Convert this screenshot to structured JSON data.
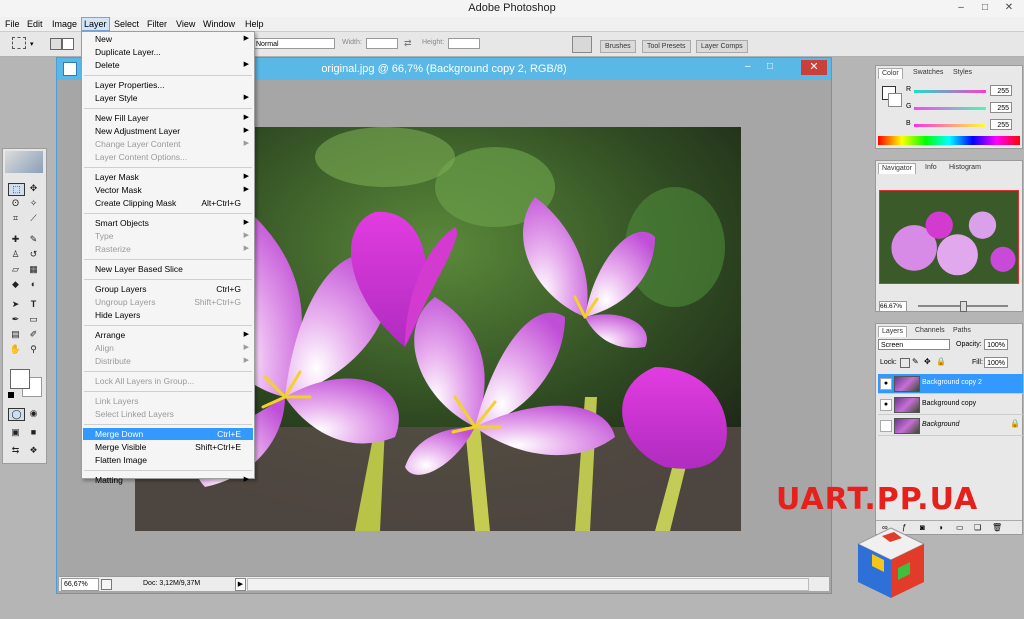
{
  "app": {
    "title": "Adobe Photoshop"
  },
  "window_controls": [
    "–",
    "□",
    "✕"
  ],
  "menubar": [
    "File",
    "Edit",
    "Image",
    "Layer",
    "Select",
    "Filter",
    "View",
    "Window",
    "Help"
  ],
  "options": {
    "mode": "Normal",
    "width_label": "Width:",
    "height_label": "Height:",
    "panel_tabs": [
      "Brushes",
      "Tool Presets",
      "Layer Comps"
    ]
  },
  "document": {
    "title": "original.jpg @ 66,7% (Background copy 2, RGB/8)",
    "zoom": "66,67%",
    "doc_info": "Doc: 3,12M/9,37M"
  },
  "layer_menu": {
    "items": [
      {
        "label": "New",
        "shortcut": "",
        "submenu": true,
        "disabled": false
      },
      {
        "label": "Duplicate Layer...",
        "shortcut": "",
        "submenu": false,
        "disabled": false
      },
      {
        "label": "Delete",
        "shortcut": "",
        "submenu": true,
        "disabled": false
      },
      {
        "sep": true
      },
      {
        "label": "Layer Properties...",
        "shortcut": "",
        "submenu": false,
        "disabled": false
      },
      {
        "label": "Layer Style",
        "shortcut": "",
        "submenu": true,
        "disabled": false
      },
      {
        "sep": true
      },
      {
        "label": "New Fill Layer",
        "shortcut": "",
        "submenu": true,
        "disabled": false
      },
      {
        "label": "New Adjustment Layer",
        "shortcut": "",
        "submenu": true,
        "disabled": false
      },
      {
        "label": "Change Layer Content",
        "shortcut": "",
        "submenu": true,
        "disabled": true
      },
      {
        "label": "Layer Content Options...",
        "shortcut": "",
        "submenu": false,
        "disabled": true
      },
      {
        "sep": true
      },
      {
        "label": "Layer Mask",
        "shortcut": "",
        "submenu": true,
        "disabled": false
      },
      {
        "label": "Vector Mask",
        "shortcut": "",
        "submenu": true,
        "disabled": false
      },
      {
        "label": "Create Clipping Mask",
        "shortcut": "Alt+Ctrl+G",
        "submenu": false,
        "disabled": false
      },
      {
        "sep": true
      },
      {
        "label": "Smart Objects",
        "shortcut": "",
        "submenu": true,
        "disabled": false
      },
      {
        "label": "Type",
        "shortcut": "",
        "submenu": true,
        "disabled": true
      },
      {
        "label": "Rasterize",
        "shortcut": "",
        "submenu": true,
        "disabled": true
      },
      {
        "sep": true
      },
      {
        "label": "New Layer Based Slice",
        "shortcut": "",
        "submenu": false,
        "disabled": false
      },
      {
        "sep": true
      },
      {
        "label": "Group Layers",
        "shortcut": "Ctrl+G",
        "submenu": false,
        "disabled": false
      },
      {
        "label": "Ungroup Layers",
        "shortcut": "Shift+Ctrl+G",
        "submenu": false,
        "disabled": true
      },
      {
        "label": "Hide Layers",
        "shortcut": "",
        "submenu": false,
        "disabled": false
      },
      {
        "sep": true
      },
      {
        "label": "Arrange",
        "shortcut": "",
        "submenu": true,
        "disabled": false
      },
      {
        "label": "Align",
        "shortcut": "",
        "submenu": true,
        "disabled": true
      },
      {
        "label": "Distribute",
        "shortcut": "",
        "submenu": true,
        "disabled": true
      },
      {
        "sep": true
      },
      {
        "label": "Lock All Layers in Group...",
        "shortcut": "",
        "submenu": false,
        "disabled": true
      },
      {
        "sep": true
      },
      {
        "label": "Link Layers",
        "shortcut": "",
        "submenu": false,
        "disabled": true
      },
      {
        "label": "Select Linked Layers",
        "shortcut": "",
        "submenu": false,
        "disabled": true
      },
      {
        "sep": true
      },
      {
        "label": "Merge Down",
        "shortcut": "Ctrl+E",
        "submenu": false,
        "disabled": false,
        "highlighted": true
      },
      {
        "label": "Merge Visible",
        "shortcut": "Shift+Ctrl+E",
        "submenu": false,
        "disabled": false
      },
      {
        "label": "Flatten Image",
        "shortcut": "",
        "submenu": false,
        "disabled": false
      },
      {
        "sep": true
      },
      {
        "label": "Matting",
        "shortcut": "",
        "submenu": true,
        "disabled": false
      }
    ]
  },
  "color_panel": {
    "tabs": [
      "Color",
      "Swatches",
      "Styles"
    ],
    "channels": [
      {
        "name": "R",
        "value": "255",
        "color": "#ff3b3b"
      },
      {
        "name": "G",
        "value": "255",
        "color": "#2fd27a"
      },
      {
        "name": "B",
        "value": "255",
        "color": "#e8e82a"
      }
    ]
  },
  "navigator_panel": {
    "tabs": [
      "Navigator",
      "Info",
      "Histogram"
    ],
    "zoom": "66.67%"
  },
  "layers_panel": {
    "tabs": [
      "Layers",
      "Channels",
      "Paths"
    ],
    "blend_mode": "Screen",
    "opacity_label": "Opacity:",
    "opacity": "100%",
    "lock_label": "Lock:",
    "fill_label": "Fill:",
    "fill": "100%",
    "layers": [
      {
        "name": "Background copy 2",
        "selected": true,
        "italic": false,
        "visible": true
      },
      {
        "name": "Background copy",
        "selected": false,
        "italic": false,
        "visible": true
      },
      {
        "name": "Background",
        "selected": false,
        "italic": true,
        "visible": false
      }
    ]
  },
  "watermark": {
    "text": "UART.PP.UA"
  },
  "colors": {
    "doc_titlebar": "#5ab8e6",
    "selection": "#3399ff",
    "watermark": "#e8201c"
  }
}
